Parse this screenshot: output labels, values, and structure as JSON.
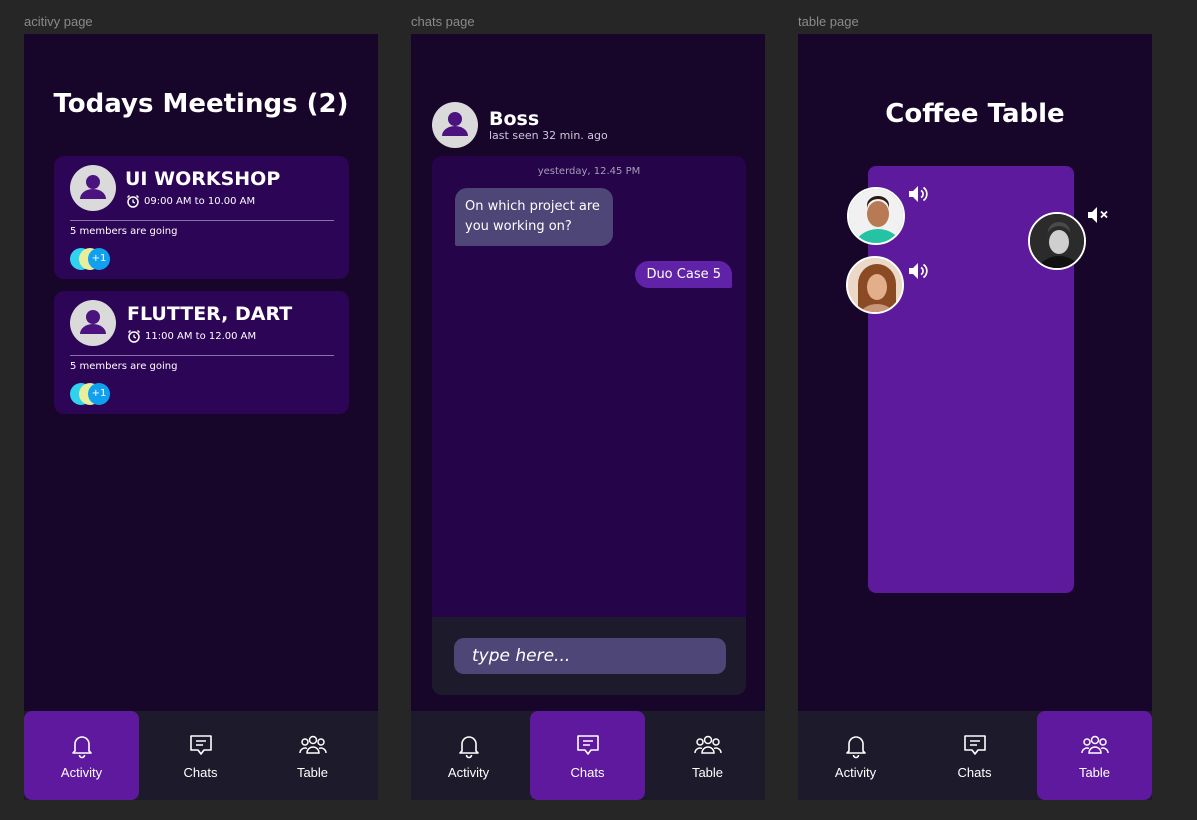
{
  "frames": {
    "activity": "acitivy page",
    "chats": "chats page",
    "table": "table page"
  },
  "nav": {
    "activity": "Activity",
    "chats": "Chats",
    "table": "Table"
  },
  "activity": {
    "title": "Todays Meetings (2)",
    "meetings": [
      {
        "title": "UI WORKSHOP",
        "time": "09:00 AM to 10.00 AM",
        "members": "5 members are going",
        "extra": "+1"
      },
      {
        "title": "FLUTTER, DART",
        "time": "11:00 AM to 12.00 AM",
        "members": "5 members are going",
        "extra": "+1"
      }
    ]
  },
  "chats": {
    "contact_name": "Boss",
    "last_seen": "last seen 32 min. ago",
    "timestamp": "yesterday, 12.45 PM",
    "messages": [
      {
        "from": "them",
        "text": "On which project are you working on?"
      },
      {
        "from": "me",
        "text": "Duo Case 5"
      }
    ],
    "input_placeholder": "type here..."
  },
  "table": {
    "title": "Coffee Table",
    "participants": [
      {
        "icon": "speaker-on-icon"
      },
      {
        "icon": "speaker-on-icon"
      },
      {
        "icon": "speaker-muted-icon"
      }
    ]
  },
  "colors": {
    "background": "#262626",
    "screen": "#17052a",
    "card": "#2c0557",
    "accent": "#5e199e",
    "nav": "#1d1a2b",
    "bubble_in": "#4e4677",
    "bubble_out": "#6023a8"
  }
}
